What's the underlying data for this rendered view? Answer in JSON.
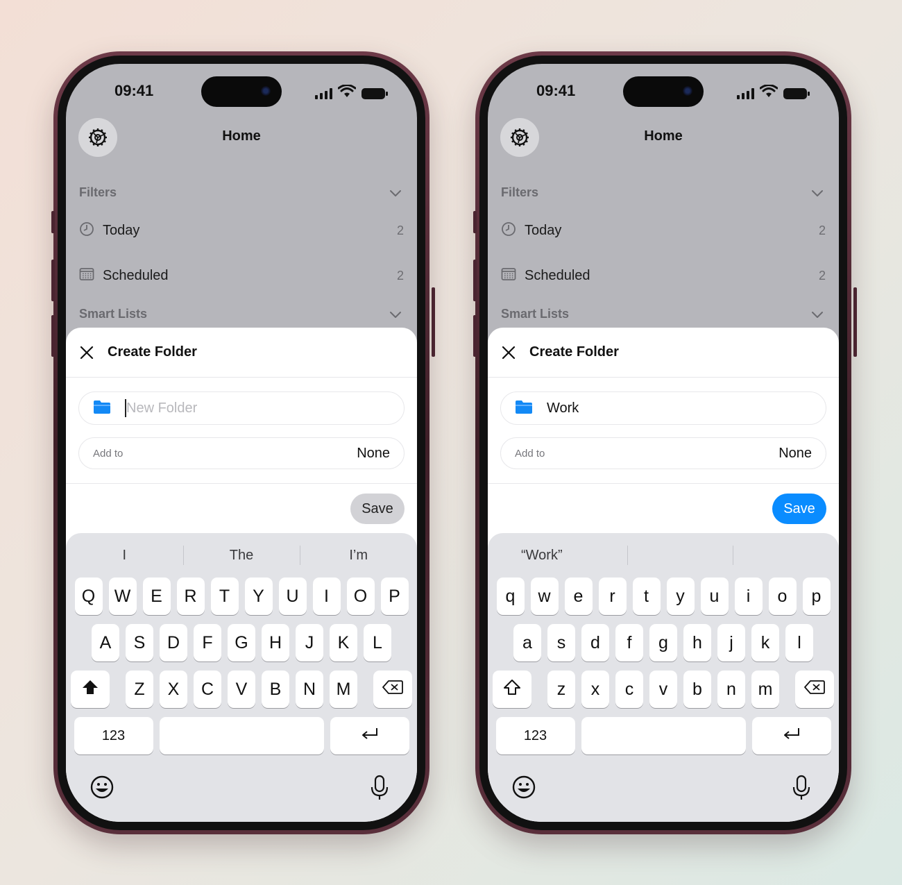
{
  "phones": [
    {
      "status": {
        "time": "09:41"
      },
      "header": {
        "title": "Home"
      },
      "sections": {
        "filters": "Filters",
        "smart_lists": "Smart Lists"
      },
      "rows": {
        "today": {
          "label": "Today",
          "count": "2"
        },
        "scheduled": {
          "label": "Scheduled",
          "count": "2"
        }
      },
      "sheet": {
        "title": "Create Folder",
        "name_placeholder": "New Folder",
        "name_value": "",
        "add_to_label": "Add to",
        "add_to_value": "None",
        "save_label": "Save",
        "save_enabled": false
      },
      "keyboard": {
        "suggestions": [
          "I",
          "The",
          "I’m"
        ],
        "row1": [
          "Q",
          "W",
          "E",
          "R",
          "T",
          "Y",
          "U",
          "I",
          "O",
          "P"
        ],
        "row2": [
          "A",
          "S",
          "D",
          "F",
          "G",
          "H",
          "J",
          "K",
          "L"
        ],
        "row3": [
          "Z",
          "X",
          "C",
          "V",
          "B",
          "N",
          "M"
        ],
        "numbers_label": "123",
        "shift_active": true
      }
    },
    {
      "status": {
        "time": "09:41"
      },
      "header": {
        "title": "Home"
      },
      "sections": {
        "filters": "Filters",
        "smart_lists": "Smart Lists"
      },
      "rows": {
        "today": {
          "label": "Today",
          "count": "2"
        },
        "scheduled": {
          "label": "Scheduled",
          "count": "2"
        }
      },
      "sheet": {
        "title": "Create Folder",
        "name_placeholder": "",
        "name_value": "Work",
        "add_to_label": "Add to",
        "add_to_value": "None",
        "save_label": "Save",
        "save_enabled": true
      },
      "keyboard": {
        "suggestions": [
          "“Work”",
          "",
          ""
        ],
        "row1": [
          "q",
          "w",
          "e",
          "r",
          "t",
          "y",
          "u",
          "i",
          "o",
          "p"
        ],
        "row2": [
          "a",
          "s",
          "d",
          "f",
          "g",
          "h",
          "j",
          "k",
          "l"
        ],
        "row3": [
          "z",
          "x",
          "c",
          "v",
          "b",
          "n",
          "m"
        ],
        "numbers_label": "123",
        "shift_active": false
      }
    }
  ],
  "colors": {
    "accent": "#0a8cff",
    "frame": "#5a2f3b",
    "dimmed_bg": "#b6b6bb"
  },
  "icons": [
    "gear-icon",
    "chevron-down-icon",
    "clock-icon",
    "calendar-icon",
    "close-icon",
    "folder-icon",
    "shift-icon",
    "delete-icon",
    "return-icon",
    "emoji-icon",
    "mic-icon",
    "wifi-icon",
    "signal-icon",
    "battery-icon"
  ]
}
